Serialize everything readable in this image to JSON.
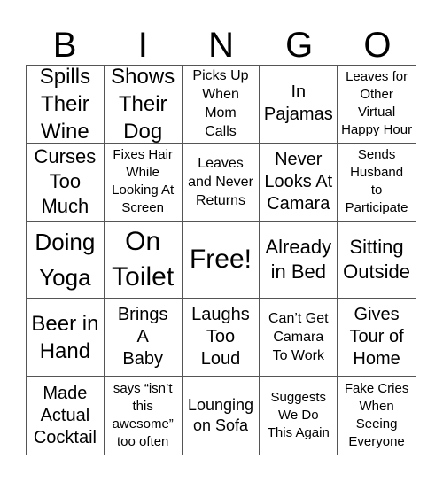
{
  "header": [
    "B",
    "I",
    "N",
    "G",
    "O"
  ],
  "cells": [
    "Spills\nTheir\nWine",
    "Shows\nTheir\nDog",
    "Picks Up\nWhen\nMom\nCalls",
    "In\nPajamas",
    "Leaves for\nOther\nVirtual\nHappy Hour",
    "Curses\nToo\nMuch",
    "Fixes Hair\nWhile\nLooking At\nScreen",
    "Leaves\nand Never\nReturns",
    "Never\nLooks At\nCamara",
    "Sends\nHusband\nto\nParticipate",
    "Doing\nYoga",
    "On\nToilet",
    "Free!",
    "Already\nin Bed",
    "Sitting\nOutside",
    "Beer in\nHand",
    "Brings\nA\nBaby",
    "Laughs\nToo\nLoud",
    "Can’t Get\nCamara\nTo Work",
    "Gives\nTour of\nHome",
    "Made\nActual\nCocktail",
    "says “isn’t\nthis\nawesome”\ntoo often",
    "Lounging\non Sofa",
    "Suggests\nWe Do\nThis Again",
    "Fake Cries\nWhen\nSeeing\nEveryone"
  ]
}
